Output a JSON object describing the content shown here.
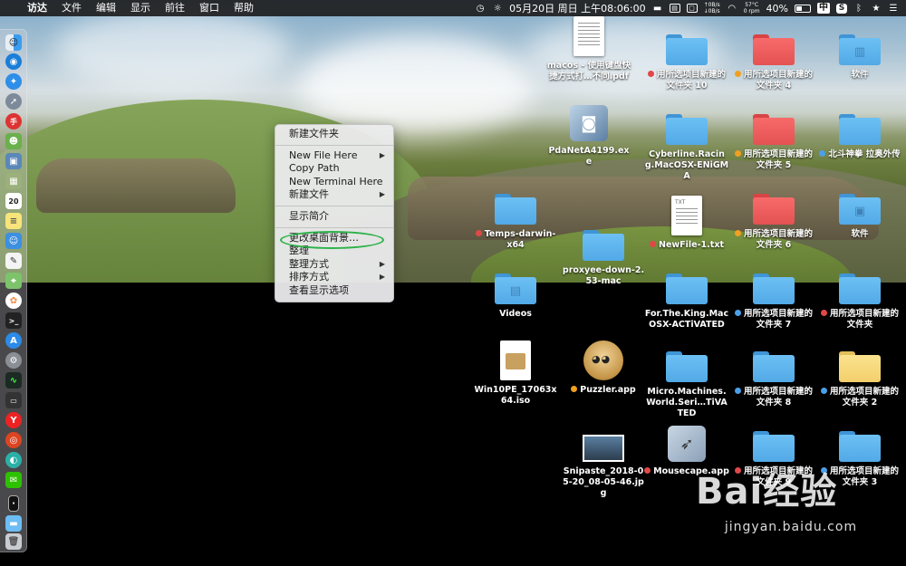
{
  "menubar": {
    "apple": "",
    "items": [
      "访达",
      "文件",
      "编辑",
      "显示",
      "前往",
      "窗口",
      "帮助"
    ],
    "net_up": "0B/s",
    "net_down": "0B/s",
    "temp": "57°C",
    "temp_unit": "0 rpm",
    "clock": "05月20日 周日 上午08:06:00",
    "battery": "40%",
    "input_method": "中"
  },
  "context_menu": {
    "items": [
      {
        "label": "新建文件夹",
        "submenu": false
      },
      {
        "label": "New File Here",
        "submenu": true
      },
      {
        "label": "Copy Path",
        "submenu": false
      },
      {
        "label": "New Terminal Here",
        "submenu": false
      },
      {
        "label": "新建文件",
        "submenu": true
      },
      {
        "label": "显示简介",
        "submenu": false
      },
      {
        "label": "更改桌面背景…",
        "submenu": false
      },
      {
        "label": "整理",
        "submenu": false
      },
      {
        "label": "整理方式",
        "submenu": true
      },
      {
        "label": "排序方式",
        "submenu": true
      },
      {
        "label": "查看显示选项",
        "submenu": false
      }
    ],
    "arrow_glyph": "▶"
  },
  "desktop": {
    "icons": [
      {
        "label": "macos - 使用键盘快捷方式打…不同.pdf",
        "kind": "pdf-doc",
        "tag": ""
      },
      {
        "label": "用所选项目新建的文件夹 10",
        "kind": "folder-blue",
        "tag": "#e04848"
      },
      {
        "label": "用所选项目新建的文件夹 4",
        "kind": "folder-red",
        "tag": "#f0a020"
      },
      {
        "label": "软件",
        "kind": "folder-blue-app",
        "tag": ""
      },
      {
        "label": "PdaNetA4199.exe",
        "kind": "installer",
        "tag": ""
      },
      {
        "label": "Cyberline.Racing.MacOSX-ENiGMA",
        "kind": "folder-blue",
        "tag": ""
      },
      {
        "label": "用所选项目新建的文件夹 5",
        "kind": "folder-red",
        "tag": "#f0a020"
      },
      {
        "label": "北斗神拳 拉奥外传",
        "kind": "folder-blue",
        "tag": "#4aa0e8"
      },
      {
        "label": "Temps-darwin-x64",
        "kind": "folder-blue",
        "tag": "#e04848"
      },
      {
        "label": "NewFile-1.txt",
        "kind": "txt-doc",
        "tag": "#e04848"
      },
      {
        "label": "用所选项目新建的文件夹 6",
        "kind": "folder-red",
        "tag": "#f0a020"
      },
      {
        "label": "软件",
        "kind": "folder-blue-case",
        "tag": ""
      },
      {
        "label": "proxyee-down-2.53-mac",
        "kind": "folder-blue",
        "tag": ""
      },
      {
        "label": "Videos",
        "kind": "folder-blue-video",
        "tag": ""
      },
      {
        "label": "For.The.King.MacOSX-ACTiVATED",
        "kind": "folder-blue",
        "tag": ""
      },
      {
        "label": "用所选项目新建的文件夹 7",
        "kind": "folder-blue",
        "tag": "#4aa0e8"
      },
      {
        "label": "用所选项目新建的文件夹",
        "kind": "folder-blue",
        "tag": "#e04848"
      },
      {
        "label": "Win10PE_17063x64.iso",
        "kind": "iso-doc",
        "tag": ""
      },
      {
        "label": "Puzzler.app",
        "kind": "face-app",
        "tag": "#f0a020"
      },
      {
        "label": "Micro.Machines.World.Seri…TiVATED",
        "kind": "folder-blue",
        "tag": ""
      },
      {
        "label": "用所选项目新建的文件夹 8",
        "kind": "folder-blue",
        "tag": "#4aa0e8"
      },
      {
        "label": "用所选项目新建的文件夹 2",
        "kind": "folder-yellow",
        "tag": "#4aa0e8"
      },
      {
        "label": "Snipaste_2018-05-20_08-05-46.jpg",
        "kind": "photo",
        "tag": ""
      },
      {
        "label": "Mousecape.app",
        "kind": "mousecape-app",
        "tag": "#e04848"
      },
      {
        "label": "用所选项目新建的文件夹 9",
        "kind": "folder-blue",
        "tag": "#e04848"
      },
      {
        "label": "用所选项目新建的文件夹 3",
        "kind": "folder-blue",
        "tag": "#4aa0e8"
      }
    ]
  },
  "watermark": {
    "brand": "Bai经验",
    "site": "jingyan.baidu.com"
  },
  "colors": {
    "highlight_ellipse": "#2db34a",
    "tag_red": "#e04848",
    "tag_orange": "#f0a020",
    "tag_blue": "#4aa0e8"
  }
}
